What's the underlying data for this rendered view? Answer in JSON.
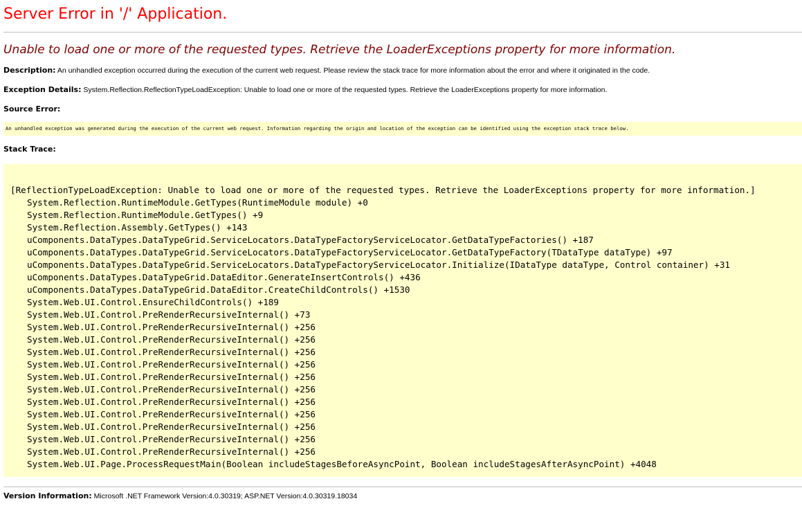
{
  "page": {
    "title": "Server Error in '/' Application.",
    "subtitle": "Unable to load one or more of the requested types. Retrieve the LoaderExceptions property for more information.",
    "colors": {
      "title": "#ff0000",
      "subtitle": "#800000",
      "code_background": "#ffffcc",
      "rule": "#c0c0c0"
    }
  },
  "description": {
    "label": "Description:",
    "text": " An unhandled exception occurred during the execution of the current web request. Please review the stack trace for more information about the error and where it originated in the code."
  },
  "exception_details": {
    "label": "Exception Details:",
    "text": " System.Reflection.ReflectionTypeLoadException: Unable to load one or more of the requested types. Retrieve the LoaderExceptions property for more information."
  },
  "source_error": {
    "label": "Source Error:",
    "text": "An unhandled exception was generated during the execution of the current web request. Information regarding the origin and location of the exception can be identified using the exception stack trace below."
  },
  "stack_trace": {
    "label": "Stack Trace:",
    "header": "[ReflectionTypeLoadException: Unable to load one or more of the requested types. Retrieve the LoaderExceptions property for more information.]",
    "frames": [
      "System.Reflection.RuntimeModule.GetTypes(RuntimeModule module) +0",
      "System.Reflection.RuntimeModule.GetTypes() +9",
      "System.Reflection.Assembly.GetTypes() +143",
      "uComponents.DataTypes.DataTypeGrid.ServiceLocators.DataTypeFactoryServiceLocator.GetDataTypeFactories() +187",
      "uComponents.DataTypes.DataTypeGrid.ServiceLocators.DataTypeFactoryServiceLocator.GetDataTypeFactory(TDataType dataType) +97",
      "uComponents.DataTypes.DataTypeGrid.ServiceLocators.DataTypeFactoryServiceLocator.Initialize(IDataType dataType, Control container) +31",
      "uComponents.DataTypes.DataTypeGrid.DataEditor.GenerateInsertControls() +436",
      "uComponents.DataTypes.DataTypeGrid.DataEditor.CreateChildControls() +1530",
      "System.Web.UI.Control.EnsureChildControls() +189",
      "System.Web.UI.Control.PreRenderRecursiveInternal() +73",
      "System.Web.UI.Control.PreRenderRecursiveInternal() +256",
      "System.Web.UI.Control.PreRenderRecursiveInternal() +256",
      "System.Web.UI.Control.PreRenderRecursiveInternal() +256",
      "System.Web.UI.Control.PreRenderRecursiveInternal() +256",
      "System.Web.UI.Control.PreRenderRecursiveInternal() +256",
      "System.Web.UI.Control.PreRenderRecursiveInternal() +256",
      "System.Web.UI.Control.PreRenderRecursiveInternal() +256",
      "System.Web.UI.Control.PreRenderRecursiveInternal() +256",
      "System.Web.UI.Control.PreRenderRecursiveInternal() +256",
      "System.Web.UI.Control.PreRenderRecursiveInternal() +256",
      "System.Web.UI.Control.PreRenderRecursiveInternal() +256",
      "System.Web.UI.Page.ProcessRequestMain(Boolean includeStagesBeforeAsyncPoint, Boolean includeStagesAfterAsyncPoint) +4048"
    ]
  },
  "version_information": {
    "label": "Version Information:",
    "text": " Microsoft .NET Framework Version:4.0.30319; ASP.NET Version:4.0.30319.18034"
  }
}
